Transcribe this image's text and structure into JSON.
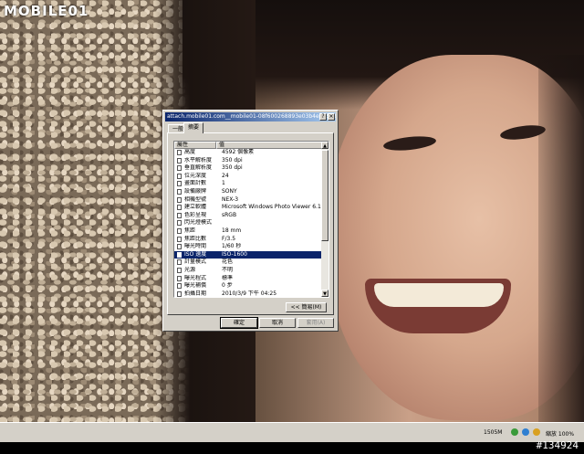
{
  "logo": {
    "text": "MOBILE01"
  },
  "dialog": {
    "title": "attach.mobile01.com__mobile01-08f600268893e03b4eb55239a3...",
    "help_label": "?",
    "close_label": "×",
    "tabs": [
      {
        "label": "一般",
        "selected": false
      },
      {
        "label": "摘要",
        "selected": true
      }
    ],
    "columns": {
      "property": "屬性",
      "value": "值"
    },
    "rows": [
      {
        "property": "高度",
        "value": "4592 個像素"
      },
      {
        "property": "水平解析度",
        "value": "350 dpi"
      },
      {
        "property": "垂直解析度",
        "value": "350 dpi"
      },
      {
        "property": "位元深度",
        "value": "24"
      },
      {
        "property": "畫面計數",
        "value": "1"
      },
      {
        "property": "設備廠牌",
        "value": "SONY"
      },
      {
        "property": "相機型號",
        "value": "NEX-3"
      },
      {
        "property": "建立軟體",
        "value": "Microsoft Windows Photo Viewer 6.1.76..."
      },
      {
        "property": "色彩呈現",
        "value": "sRGB"
      },
      {
        "property": "閃光燈模式",
        "value": ""
      },
      {
        "property": "焦距",
        "value": "18 mm"
      },
      {
        "property": "焦距比數",
        "value": "F/3.5"
      },
      {
        "property": "曝光時間",
        "value": "1/60 秒"
      },
      {
        "property": "ISO 速度",
        "value": "ISO-1600",
        "selected": true
      },
      {
        "property": "計量模式",
        "value": "花色"
      },
      {
        "property": "光源",
        "value": "不明"
      },
      {
        "property": "曝光程式",
        "value": "標準"
      },
      {
        "property": "曝光補償",
        "value": "0 步"
      },
      {
        "property": "拍攝日期",
        "value": "2010/3/9 下午 04:25"
      }
    ],
    "simple_label": "<< 簡易(M)",
    "ok_label": "確定",
    "cancel_label": "取消",
    "apply_label": "套用(A)"
  },
  "taskbar": {
    "time": "1505M",
    "zoom": "縮放 100%"
  },
  "watermark": "#134924"
}
